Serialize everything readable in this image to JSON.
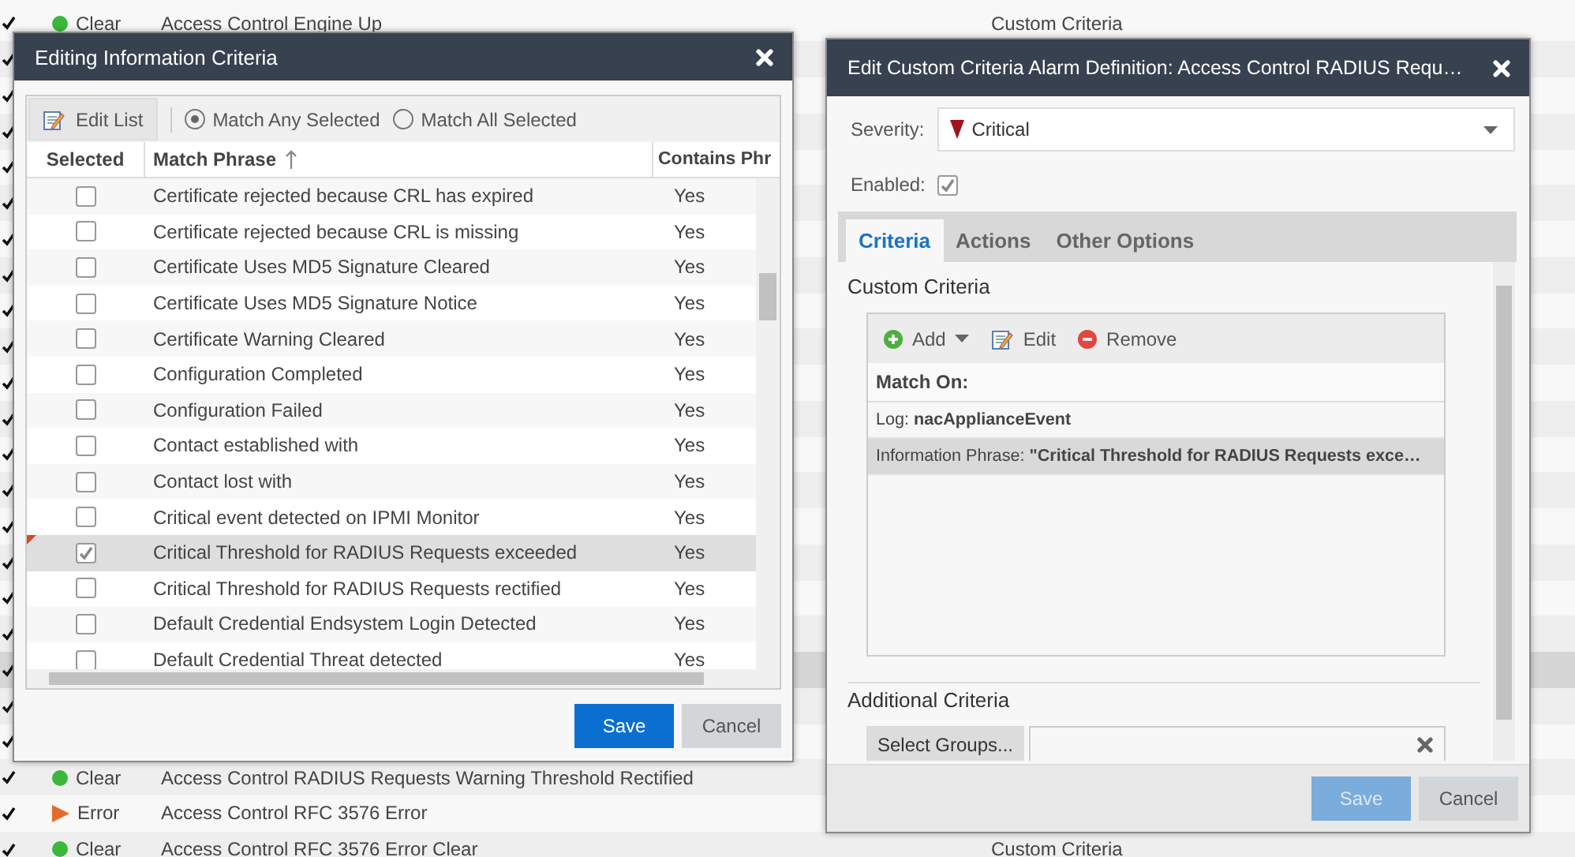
{
  "background_table": {
    "rows": [
      {
        "enabled": true,
        "selected": false,
        "status": {
          "kind": "clear",
          "label": "Clear"
        },
        "name": "Access Control Engine Up",
        "type": "Custom Criteria"
      },
      {
        "enabled": true,
        "selected": false
      },
      {
        "enabled": true,
        "selected": false
      },
      {
        "enabled": true,
        "selected": false
      },
      {
        "enabled": true,
        "selected": false
      },
      {
        "enabled": true,
        "selected": false
      },
      {
        "enabled": true,
        "selected": false
      },
      {
        "enabled": true,
        "selected": false
      },
      {
        "enabled": true,
        "selected": false
      },
      {
        "enabled": true,
        "selected": false
      },
      {
        "enabled": true,
        "selected": false
      },
      {
        "enabled": true,
        "selected": false
      },
      {
        "enabled": true,
        "selected": false
      },
      {
        "enabled": true,
        "selected": false
      },
      {
        "enabled": true,
        "selected": false
      },
      {
        "enabled": true,
        "selected": false
      },
      {
        "enabled": true,
        "selected": false
      },
      {
        "enabled": true,
        "selected": false
      },
      {
        "enabled": true,
        "selected": true
      },
      {
        "enabled": true,
        "selected": false
      },
      {
        "enabled": true,
        "selected": false
      },
      {
        "enabled": true,
        "selected": false,
        "status": {
          "kind": "clear",
          "label": "Clear"
        },
        "name": "Access Control RADIUS Requests Warning Threshold Rectified"
      },
      {
        "enabled": true,
        "selected": false,
        "status": {
          "kind": "error",
          "label": "Error"
        },
        "name": "Access Control RFC 3576 Error"
      },
      {
        "enabled": true,
        "selected": false,
        "status": {
          "kind": "clear",
          "label": "Clear"
        },
        "name": "Access Control RFC 3576 Error Clear",
        "type": "Custom Criteria"
      }
    ]
  },
  "criteria_dialog": {
    "title": "Editing Information Criteria",
    "toolbar": {
      "edit_button": "Edit List",
      "match_modes": [
        {
          "label": "Match Any Selected",
          "selected": true
        },
        {
          "label": "Match All Selected",
          "selected": false
        }
      ]
    },
    "columns": [
      "Selected",
      "Match Phrase",
      "Contains Phr"
    ],
    "rows": [
      {
        "checked": false,
        "modified": false,
        "phrase": "Certificate rejected because CRL has expired",
        "contains": "Yes"
      },
      {
        "checked": false,
        "modified": false,
        "phrase": "Certificate rejected because CRL is missing",
        "contains": "Yes"
      },
      {
        "checked": false,
        "modified": false,
        "phrase": "Certificate Uses MD5 Signature Cleared",
        "contains": "Yes"
      },
      {
        "checked": false,
        "modified": false,
        "phrase": "Certificate Uses MD5 Signature Notice",
        "contains": "Yes"
      },
      {
        "checked": false,
        "modified": false,
        "phrase": "Certificate Warning Cleared",
        "contains": "Yes"
      },
      {
        "checked": false,
        "modified": false,
        "phrase": "Configuration Completed",
        "contains": "Yes"
      },
      {
        "checked": false,
        "modified": false,
        "phrase": "Configuration Failed",
        "contains": "Yes"
      },
      {
        "checked": false,
        "modified": false,
        "phrase": "Contact established with",
        "contains": "Yes"
      },
      {
        "checked": false,
        "modified": false,
        "phrase": "Contact lost with",
        "contains": "Yes"
      },
      {
        "checked": false,
        "modified": false,
        "phrase": "Critical event detected on IPMI Monitor",
        "contains": "Yes"
      },
      {
        "checked": true,
        "modified": true,
        "phrase": "Critical Threshold for RADIUS Requests exceeded",
        "contains": "Yes"
      },
      {
        "checked": false,
        "modified": false,
        "phrase": "Critical Threshold for RADIUS Requests rectified",
        "contains": "Yes"
      },
      {
        "checked": false,
        "modified": false,
        "phrase": "Default Credential Endsystem Login Detected",
        "contains": "Yes"
      },
      {
        "checked": false,
        "modified": false,
        "phrase": "Default Credential Threat detected",
        "contains": "Yes"
      }
    ],
    "buttons": [
      {
        "label": "Save",
        "kind": "primary",
        "disabled": false
      },
      {
        "label": "Cancel",
        "kind": "secondary",
        "disabled": false
      }
    ]
  },
  "alarm_dialog": {
    "title": "Edit Custom Criteria Alarm Definition: Access Control RADIUS Requ…",
    "severity": {
      "label": "Severity:",
      "value": "Critical"
    },
    "enabled": {
      "label": "Enabled:",
      "checked": true
    },
    "tabs": [
      {
        "label": "Criteria",
        "selected": true
      },
      {
        "label": "Actions",
        "selected": false
      },
      {
        "label": "Other Options",
        "selected": false
      }
    ],
    "custom_criteria": {
      "heading": "Custom Criteria",
      "toolbar": [
        {
          "kind": "add",
          "label": "Add"
        },
        {
          "kind": "edit",
          "label": "Edit"
        },
        {
          "kind": "remove",
          "label": "Remove"
        }
      ],
      "header": "Match On:",
      "rows": [
        {
          "text": "Log: **nacApplianceEvent**",
          "selected": false
        },
        {
          "text": "Information Phrase: **\"Critical Threshold for RADIUS Requests exce…**",
          "selected": true
        }
      ]
    },
    "additional_criteria": {
      "heading": "Additional Criteria",
      "button": "Select Groups..."
    },
    "buttons": [
      {
        "label": "Save",
        "kind": "primary",
        "disabled": true
      },
      {
        "label": "Cancel",
        "kind": "secondary",
        "disabled": false
      }
    ]
  }
}
